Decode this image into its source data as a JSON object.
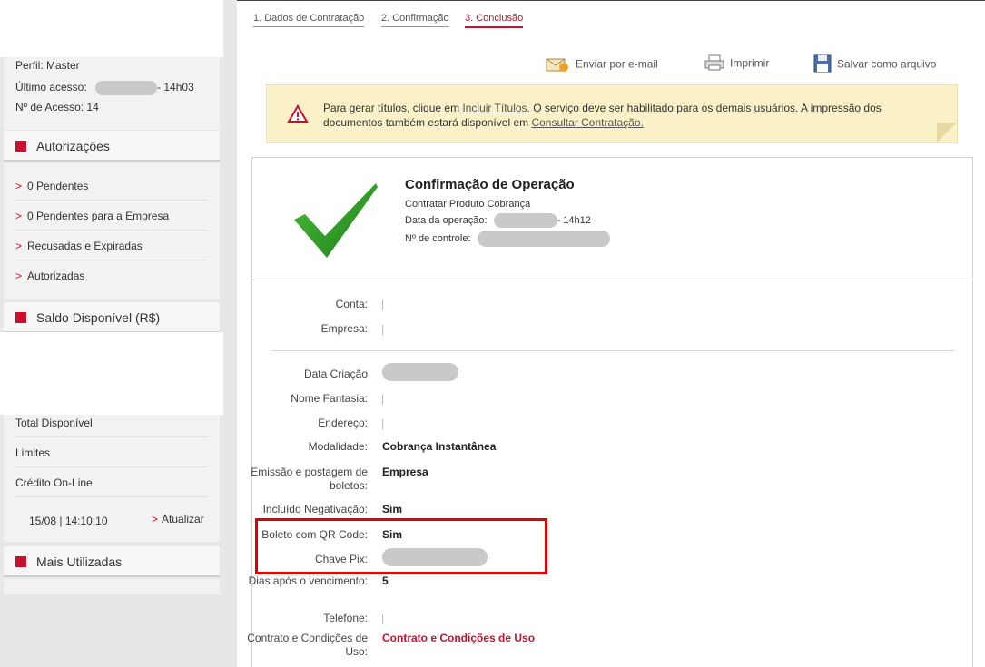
{
  "sidebar": {
    "profile": "Perfil: Master",
    "last_access_label": "Último acesso:",
    "last_access_time": "- 14h03",
    "access_count": "Nº de Acesso: 14",
    "sections": {
      "autorizacoes": "Autorizações",
      "saldo": "Saldo Disponível (R$)",
      "mais": "Mais Utilizadas"
    },
    "auth_items": [
      "0 Pendentes",
      "0 Pendentes para a Empresa",
      "Recusadas e Expiradas",
      "Autorizadas"
    ],
    "saldo_items": [
      "Total Disponível",
      "Limites",
      "Crédito On-Line"
    ],
    "update_time": "15/08 | 14:10:10",
    "update_label": "Atualizar"
  },
  "steps": [
    "1. Dados de Contratação",
    "2. Confirmação",
    "3. Conclusão"
  ],
  "actions": {
    "email": "Enviar por e-mail",
    "print": "Imprimir",
    "save": "Salvar como arquivo"
  },
  "warning": {
    "pre": "Para gerar títulos, clique em ",
    "link1": "Incluir Títulos.",
    "mid": " O serviço deve ser habilitado para os demais usuários. A impressão dos documentos também estará disponível em ",
    "link2": "Consultar Contratação."
  },
  "confirmation": {
    "title": "Confirmação de Operação",
    "subtitle": "Contratar Produto Cobrança",
    "date_label": "Data da operação:",
    "date_time": "- 14h12",
    "control_label": "Nº de controle:"
  },
  "fields": {
    "conta": "Conta:",
    "empresa": "Empresa:",
    "data_criacao": "Data Criação",
    "nome_fantasia": "Nome Fantasia:",
    "endereco": "Endereço:",
    "modalidade": "Modalidade:",
    "modalidade_val": "Cobrança Instantânea",
    "emissao": "Emissão e postagem de boletos:",
    "emissao_val": "Empresa",
    "negativacao": "Incluído Negativação:",
    "negativacao_val": "Sim",
    "qrcode": "Boleto com QR Code:",
    "qrcode_val": "Sim",
    "pix": "Chave Pix:",
    "dias": "Dias após o vencimento:",
    "dias_val": "5",
    "telefone": "Telefone:",
    "contrato": "Contrato e Condições de Uso:",
    "contrato_val": "Contrato e Condições de Uso"
  },
  "colors": {
    "brand_red": "#c8102e",
    "warning_bg": "#fbf1c8",
    "highlight": "#e00000"
  }
}
